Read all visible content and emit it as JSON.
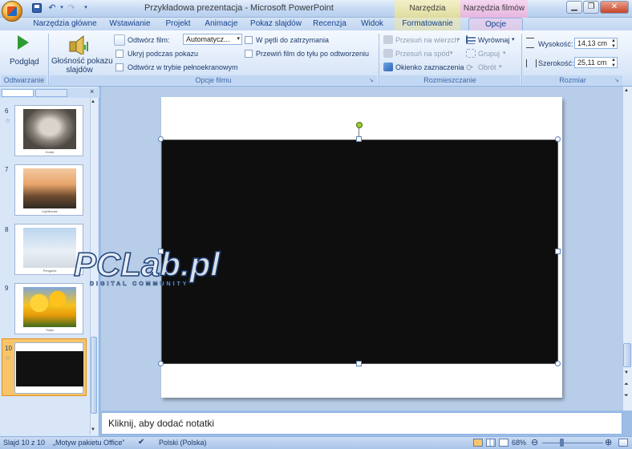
{
  "window": {
    "title": "Przykładowa prezentacja - Microsoft PowerPoint",
    "context_img": "Narzędzia obrazów",
    "context_film": "Narzędzia filmów"
  },
  "tabs": [
    "Narzędzia główne",
    "Wstawianie",
    "Projekt",
    "Animacje",
    "Pokaz slajdów",
    "Recenzja",
    "Widok",
    "Formatowanie",
    "Opcje"
  ],
  "active_tab": "Opcje",
  "ribbon": {
    "preview": "Podgląd",
    "volume_line1": "Głośność pokazu",
    "volume_line2": "slajdów",
    "play_film_label": "Odtwórz film:",
    "play_film_value": "Automatycz...",
    "hide_during_show": "Ukryj podczas pokazu",
    "play_fullscreen": "Odtwórz w trybie pełnoekranowym",
    "loop": "W pętli do zatrzymania",
    "rewind": "Przewiń film do tyłu po odtworzeniu",
    "bring_forward": "Przesuń na wierzch",
    "send_backward": "Przesuń na spód",
    "selection_pane": "Okienko zaznaczenia",
    "align": "Wyrównaj",
    "group": "Grupuj",
    "rotate": "Obrót",
    "height_label": "Wysokość:",
    "height_value": "14,13 cm",
    "width_label": "Szerokość:",
    "width_value": "25,11 cm",
    "group_play": "Odtwarzanie",
    "group_film_options": "Opcje filmu",
    "group_arrange": "Rozmieszczanie",
    "group_size": "Rozmiar"
  },
  "slides": [
    {
      "num": "6",
      "caption": "Koala"
    },
    {
      "num": "7",
      "caption": "Lighthouse"
    },
    {
      "num": "8",
      "caption": "Penguins"
    },
    {
      "num": "9",
      "caption": "Tulips"
    },
    {
      "num": "10",
      "caption": ""
    }
  ],
  "notes_placeholder": "Kliknij, aby dodać notatki",
  "status": {
    "slide": "Slajd 10 z 10",
    "theme": "„Motyw pakietu Office”",
    "language": "Polski (Polska)",
    "zoom": "68%"
  },
  "watermark": {
    "logo": "PCLab.pl",
    "tagline": "DIGITAL COMMUNITY"
  },
  "colors": {
    "accent": "#15428b",
    "video": "#0e0e0e",
    "ctx_img": "#e8e3a5",
    "ctx_film": "#ecbfe4"
  }
}
